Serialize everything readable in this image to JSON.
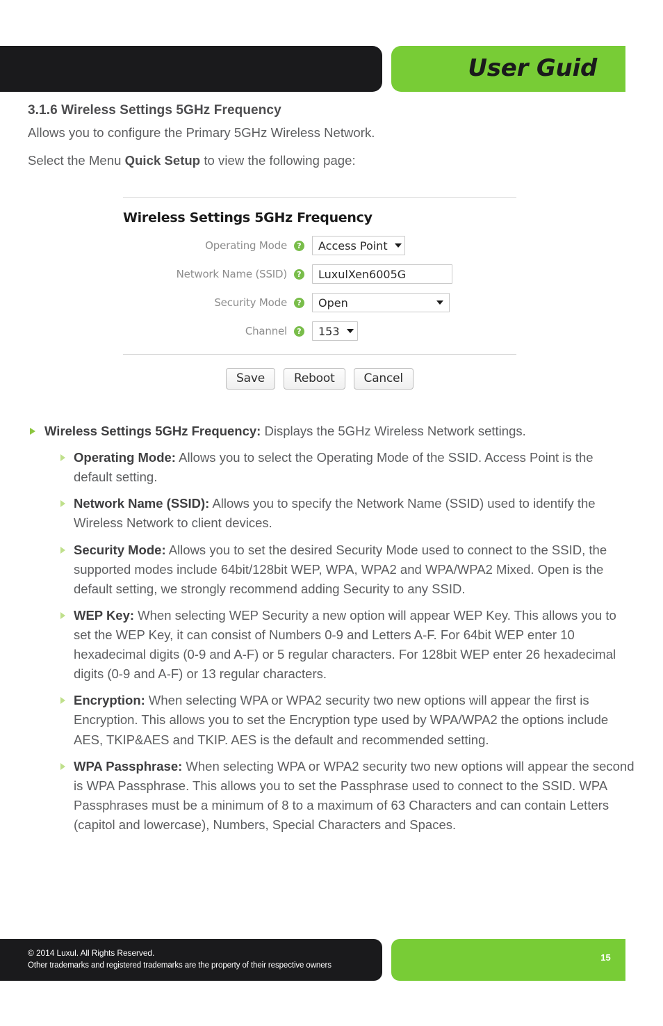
{
  "header": {
    "title": "User Guide",
    "accent_color": "#78cc36",
    "dark_color": "#1a1a1c"
  },
  "doc": {
    "section_heading": "3.1.6 Wireless Settings 5GHz Frequency",
    "intro_paragraph": "Allows you to configure the Primary 5GHz Wireless Network.",
    "instruction_prefix": "Select the Menu ",
    "instruction_bold": "Quick Setup",
    "instruction_suffix": " to view the following page:"
  },
  "screenshot": {
    "panel_title": "Wireless Settings 5GHz Frequency",
    "fields": [
      {
        "label": "Operating Mode",
        "type": "select",
        "value": "Access Point",
        "help": "?"
      },
      {
        "label": "Network Name (SSID)",
        "type": "text",
        "value": "LuxulXen6005G",
        "help": "?"
      },
      {
        "label": "Security Mode",
        "type": "select",
        "value": "Open",
        "help": "?"
      },
      {
        "label": "Channel",
        "type": "select",
        "value": "153",
        "help": "?"
      }
    ],
    "buttons": {
      "save": "Save",
      "reboot": "Reboot",
      "cancel": "Cancel"
    }
  },
  "bullets": {
    "top": {
      "lead": "Wireless Settings 5GHz Frequency:",
      "text": " Displays the 5GHz Wireless Network settings."
    },
    "items": [
      {
        "lead": "Operating Mode:",
        "text": " Allows you to select the Operating Mode of the SSID. Access Point is the default setting."
      },
      {
        "lead": "Network Name (SSID):",
        "text": " Allows you to specify the Network Name (SSID) used to identify the Wireless Network to client devices."
      },
      {
        "lead": "Security Mode:",
        "text": " Allows you to set the desired Security Mode used to connect to the SSID, the supported modes include 64bit/128bit WEP, WPA, WPA2 and WPA/WPA2 Mixed. Open is the default setting, we strongly recommend adding Security to any SSID."
      },
      {
        "lead": "WEP Key:",
        "text": " When selecting WEP Security a new option will appear WEP Key. This allows you to set the WEP Key, it can consist of Numbers 0-9 and Letters A-F. For 64bit WEP enter 10 hexadecimal digits (0-9 and A-F) or 5 regular characters. For 128bit WEP enter 26 hexadecimal digits (0-9 and A-F) or 13 regular characters."
      },
      {
        "lead": "Encryption:",
        "text": " When selecting WPA or WPA2 security two new options will appear the first is Encryption. This allows you to set the Encryption type used by WPA/WPA2 the options include AES, TKIP&AES and TKIP. AES is the default and recommended setting."
      },
      {
        "lead": "WPA Passphrase:",
        "text": " When selecting WPA or WPA2 security two new options will appear the second is WPA Passphrase. This allows you to set the Passphrase used to connect to the SSID. WPA Passphrases must be a minimum of 8 to a maximum of 63 Characters and can contain Letters (capitol and lowercase), Numbers, Special Characters and Spaces."
      }
    ]
  },
  "footer": {
    "copyright": "© 2014  Luxul. All Rights Reserved.",
    "trademarks": "Other trademarks and registered trademarks are the property of their respective owners",
    "page_number": "15"
  }
}
